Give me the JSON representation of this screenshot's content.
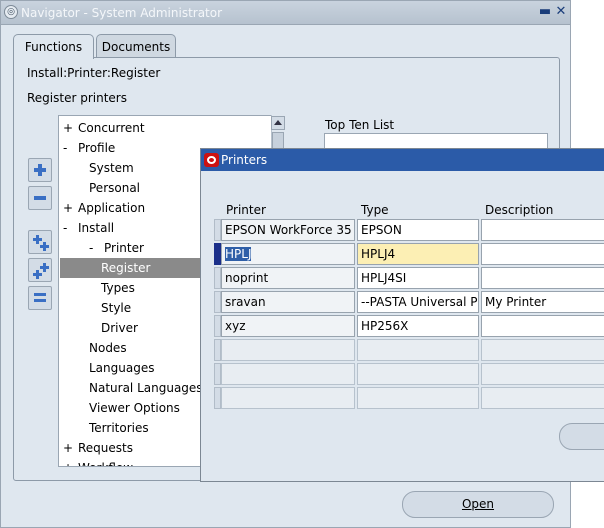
{
  "navigator": {
    "title": "Navigator - System Administrator",
    "tabs": [
      {
        "label": "Functions",
        "active": true
      },
      {
        "label": "Documents",
        "active": false
      }
    ],
    "path": "Install:Printer:Register",
    "section_label": "Register printers",
    "top_ten_label": "Top Ten List",
    "open_button_label": "Open",
    "tree": [
      {
        "prefix": "+",
        "label": "Concurrent",
        "level": 0
      },
      {
        "prefix": "-",
        "label": "Profile",
        "level": 0
      },
      {
        "prefix": "",
        "label": "System",
        "level": 1
      },
      {
        "prefix": "",
        "label": "Personal",
        "level": 1
      },
      {
        "prefix": "+",
        "label": "Application",
        "level": 0
      },
      {
        "prefix": "-",
        "label": "Install",
        "level": 0
      },
      {
        "prefix": "-",
        "label": "Printer",
        "level": 1
      },
      {
        "prefix": "",
        "label": "Register",
        "level": 2,
        "selected": true
      },
      {
        "prefix": "",
        "label": "Types",
        "level": 2
      },
      {
        "prefix": "",
        "label": "Style",
        "level": 2
      },
      {
        "prefix": "",
        "label": "Driver",
        "level": 2
      },
      {
        "prefix": "",
        "label": "Nodes",
        "level": 1
      },
      {
        "prefix": "",
        "label": "Languages",
        "level": 1
      },
      {
        "prefix": "",
        "label": "Natural Languages",
        "level": 1
      },
      {
        "prefix": "",
        "label": "Viewer Options",
        "level": 1
      },
      {
        "prefix": "",
        "label": "Territories",
        "level": 1
      },
      {
        "prefix": "+",
        "label": "Requests",
        "level": 0
      },
      {
        "prefix": "+",
        "label": "Workflow",
        "level": 0
      }
    ]
  },
  "printers_window": {
    "title": "Printers",
    "columns": [
      "Printer",
      "Type",
      "Description"
    ],
    "rows": [
      {
        "printer": "EPSON WorkForce 35",
        "type": "EPSON",
        "description": ""
      },
      {
        "printer": "HPLJ",
        "type": "HPLJ4",
        "description": ""
      },
      {
        "printer": "noprint",
        "type": "HPLJ4SI",
        "description": ""
      },
      {
        "printer": "sravan",
        "type": "--PASTA Universal P",
        "description": "My Printer"
      },
      {
        "printer": "xyz",
        "type": "HP256X",
        "description": ""
      }
    ],
    "empty_rows": 3,
    "current_row": 1
  }
}
